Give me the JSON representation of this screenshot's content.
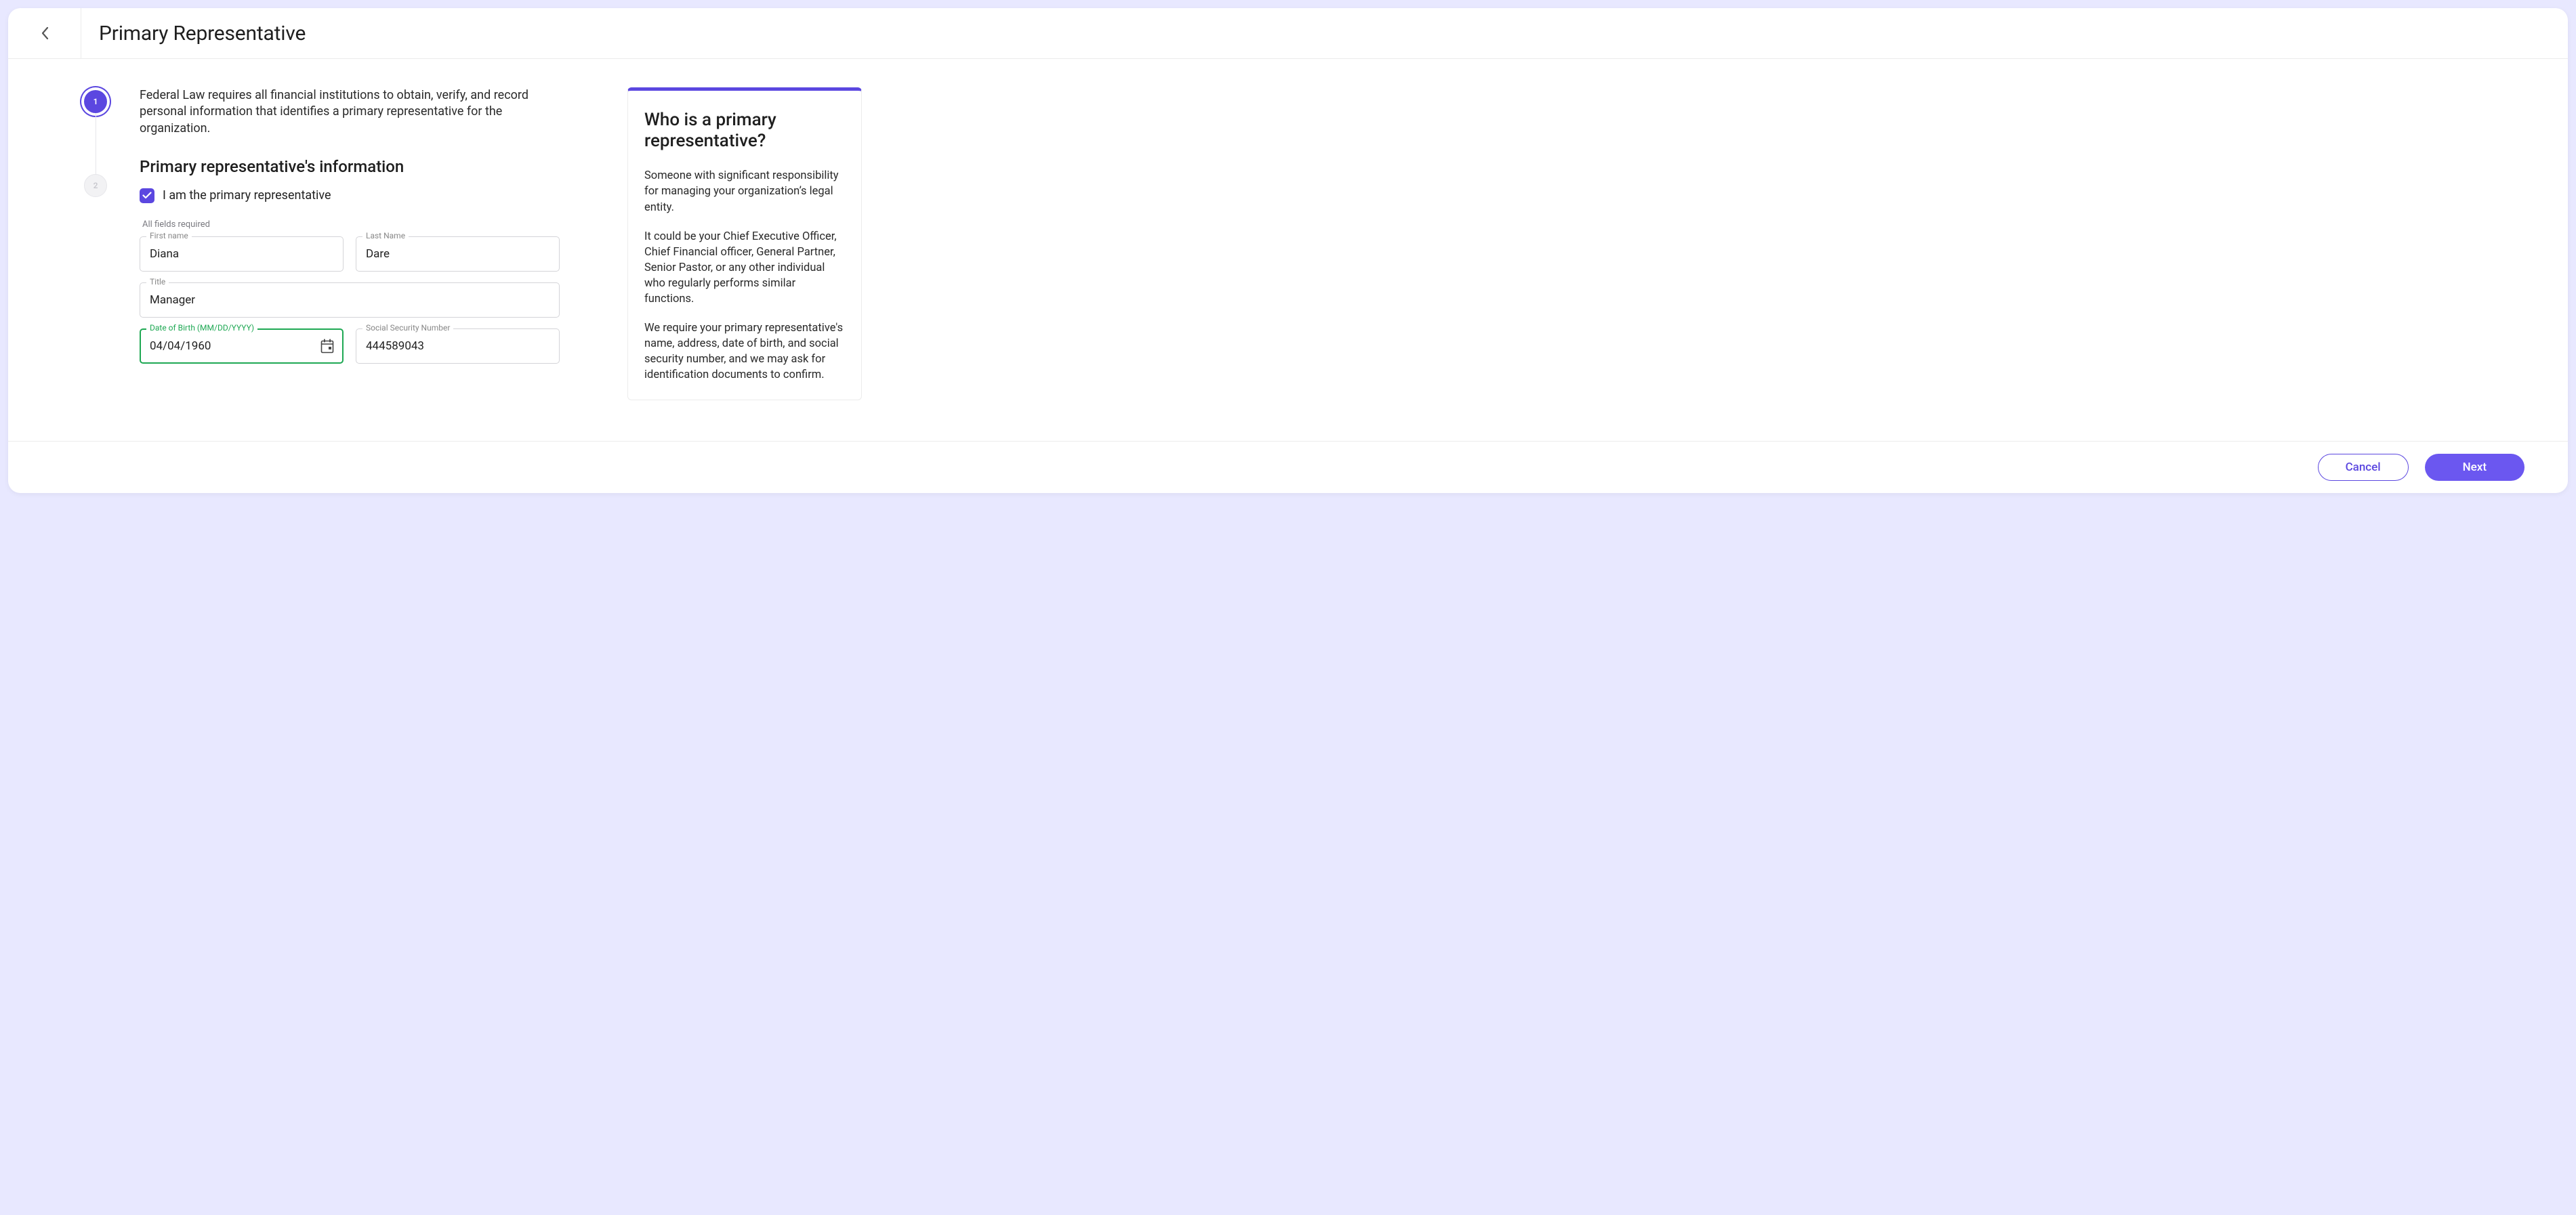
{
  "header": {
    "title": "Primary Representative"
  },
  "steps": {
    "step1": "1",
    "step2": "2"
  },
  "intro": "Federal Law requires all financial institutions to obtain, verify, and record personal information that identifies a primary representative for the organization.",
  "sectionTitle": "Primary representative's information",
  "checkbox": {
    "label": "I am the primary representative",
    "checked": true
  },
  "requiredNote": "All fields required",
  "fields": {
    "firstName": {
      "label": "First name",
      "value": "Diana"
    },
    "lastName": {
      "label": "Last Name",
      "value": "Dare"
    },
    "title": {
      "label": "Title",
      "value": "Manager"
    },
    "dob": {
      "label": "Date of Birth (MM/DD/YYYY)",
      "value": "04/04/1960"
    },
    "ssn": {
      "label": "Social Security Number",
      "value": "444589043"
    }
  },
  "info": {
    "title": "Who is a primary representative?",
    "para1": "Someone with significant responsibility for managing your organization’s legal entity.",
    "para2": "It could be your Chief Executive Officer, Chief Financial officer, General Partner, Senior Pastor, or any other individual who regularly performs similar functions.",
    "para3": "We require your primary representative's name, address, date of birth, and social security number, and we may ask for identification documents to confirm."
  },
  "footer": {
    "cancel": "Cancel",
    "next": "Next"
  }
}
